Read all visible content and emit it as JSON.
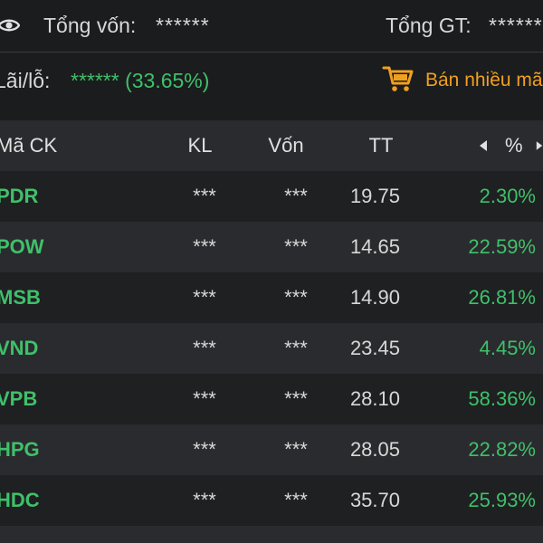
{
  "summary": {
    "total_capital_label": "Tổng vốn:",
    "total_capital_value": "******",
    "total_value_label": "Tổng GT:",
    "total_value_value": "******",
    "pnl_label": "Lãi/lỗ:",
    "pnl_value": "****** (33.65%)",
    "sell_many_label": "Bán nhiều mã"
  },
  "table": {
    "headers": {
      "symbol": "Mã CK",
      "volume": "KL",
      "capital": "Vốn",
      "market_price": "TT",
      "percent": "%"
    },
    "rows": [
      {
        "symbol": "PDR",
        "volume": "***",
        "capital": "***",
        "price": "19.75",
        "percent": "2.30%"
      },
      {
        "symbol": "POW",
        "volume": "***",
        "capital": "***",
        "price": "14.65",
        "percent": "22.59%"
      },
      {
        "symbol": "MSB",
        "volume": "***",
        "capital": "***",
        "price": "14.90",
        "percent": "26.81%"
      },
      {
        "symbol": "VND",
        "volume": "***",
        "capital": "***",
        "price": "23.45",
        "percent": "4.45%"
      },
      {
        "symbol": "VPB",
        "volume": "***",
        "capital": "***",
        "price": "28.10",
        "percent": "58.36%"
      },
      {
        "symbol": "HPG",
        "volume": "***",
        "capital": "***",
        "price": "28.05",
        "percent": "22.82%"
      },
      {
        "symbol": "HDC",
        "volume": "***",
        "capital": "***",
        "price": "35.70",
        "percent": "25.93%"
      }
    ]
  },
  "colors": {
    "positive": "#3fc06a",
    "accent": "#f0a020",
    "background": "#1b1c1e"
  },
  "icons": [
    "eye-icon",
    "cart-icon",
    "arrow-left-icon",
    "arrow-right-icon"
  ]
}
